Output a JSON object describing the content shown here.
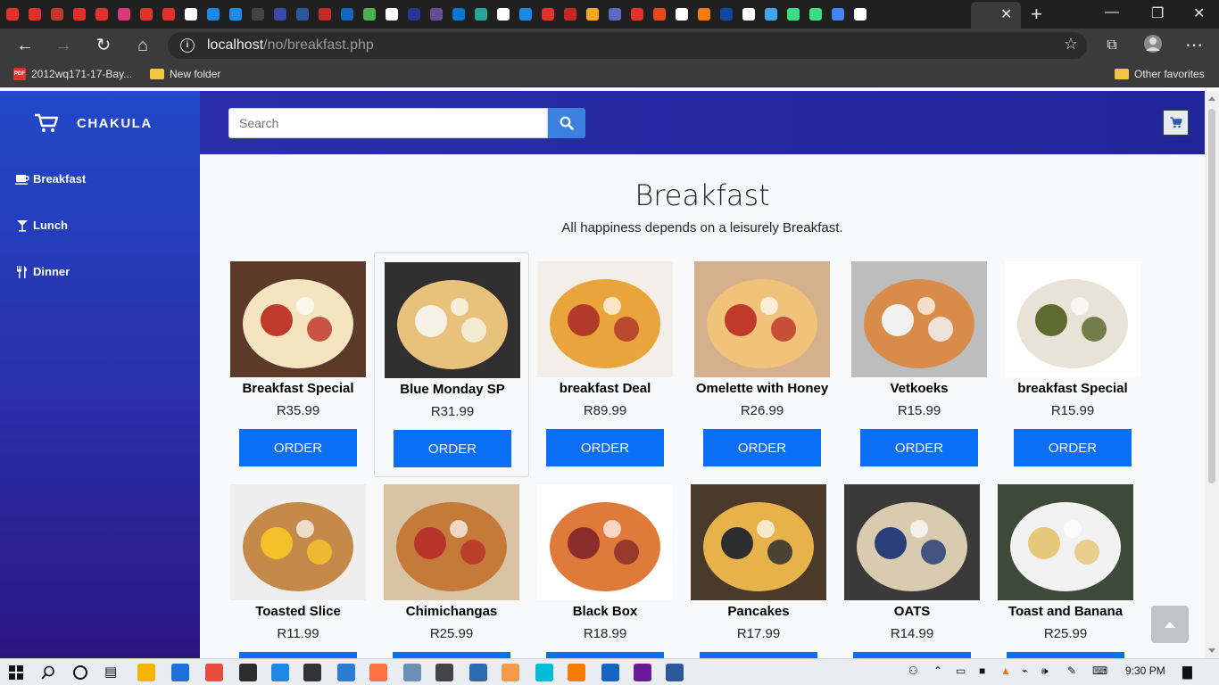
{
  "browser": {
    "url_host": "localhost",
    "url_path": "/no/breakfast.php",
    "bookmarks": [
      {
        "label": "2012wq171-17-Bay..."
      },
      {
        "label": "New folder"
      }
    ],
    "other_favorites": "Other favorites",
    "tab_favicon_colors": [
      "#e0322b",
      "#e0322b",
      "#c0392b",
      "#e0322b",
      "#e0322b",
      "#d63a7a",
      "#e0322b",
      "#e0322b",
      "#ffffff",
      "#1e88e5",
      "#1e88e5",
      "#444444",
      "#3949ab",
      "#2b579a",
      "#c62828",
      "#1565c0",
      "#4caf50",
      "#ffffff",
      "#283593",
      "#6a4c93",
      "#0078d4",
      "#26a69a",
      "#ffffff",
      "#1e88e5",
      "#e0322b",
      "#c62828",
      "#f9a825",
      "#5c6bc0",
      "#e0322b",
      "#e64a19",
      "#ffffff",
      "#f57c00",
      "#0d47a1",
      "#ffffff",
      "#42a5f5",
      "#3ddc84",
      "#3ddc84",
      "#4285f4",
      "#ffffff"
    ]
  },
  "app": {
    "brand": "CHAKULA",
    "nav": [
      {
        "label": "Breakfast",
        "icon": "coffee-icon"
      },
      {
        "label": "Lunch",
        "icon": "cocktail-icon"
      },
      {
        "label": "Dinner",
        "icon": "utensils-icon"
      }
    ],
    "search_placeholder": "Search",
    "page_title": "Breakfast",
    "page_subtitle": "All happiness depends on a leisurely Breakfast.",
    "order_label": "ORDER",
    "products": [
      {
        "name": "Breakfast Special",
        "price": "R35.99",
        "colors": [
          "#5b3a29",
          "#f4e4c0",
          "#c0392b"
        ]
      },
      {
        "name": "Blue Monday SP",
        "price": "R31.99",
        "colors": [
          "#2f2f2f",
          "#e8c27a",
          "#f6f1e4"
        ]
      },
      {
        "name": "breakfast Deal",
        "price": "R89.99",
        "colors": [
          "#f3efe8",
          "#e9a53b",
          "#b23a2b"
        ]
      },
      {
        "name": "Omelette with Honey",
        "price": "R26.99",
        "colors": [
          "#d4b08c",
          "#f0c27a",
          "#c0392b"
        ]
      },
      {
        "name": "Vetkoeks",
        "price": "R15.99",
        "colors": [
          "#bdbdbd",
          "#d98c4a",
          "#f2f2f2"
        ]
      },
      {
        "name": "breakfast Special",
        "price": "R15.99",
        "colors": [
          "#ffffff",
          "#e9e2d6",
          "#5d6b2e"
        ]
      },
      {
        "name": "Toasted Slice",
        "price": "R11.99",
        "colors": [
          "#eeeeee",
          "#c58a4a",
          "#f4c12b"
        ]
      },
      {
        "name": "Chimichangas",
        "price": "R25.99",
        "colors": [
          "#d9c3a5",
          "#c57a3a",
          "#b8352b"
        ]
      },
      {
        "name": "Black Box",
        "price": "R18.99",
        "colors": [
          "#ffffff",
          "#e07a3a",
          "#8b2e2b"
        ]
      },
      {
        "name": "Pancakes",
        "price": "R17.99",
        "colors": [
          "#4a3a2a",
          "#e8b24a",
          "#2e2e2e"
        ]
      },
      {
        "name": "OATS",
        "price": "R14.99",
        "colors": [
          "#3a3a3a",
          "#d8cbb0",
          "#2a3f7a"
        ]
      },
      {
        "name": "Toast and Banana",
        "price": "R25.99",
        "colors": [
          "#3d4a3a",
          "#f2f2f2",
          "#e6c87a"
        ]
      }
    ]
  },
  "taskbar": {
    "time": "9:30 PM"
  },
  "colors": {
    "sidebar": "#2a2fa8",
    "order_button": "#0a6ff5",
    "search_button": "#3b82e0"
  }
}
